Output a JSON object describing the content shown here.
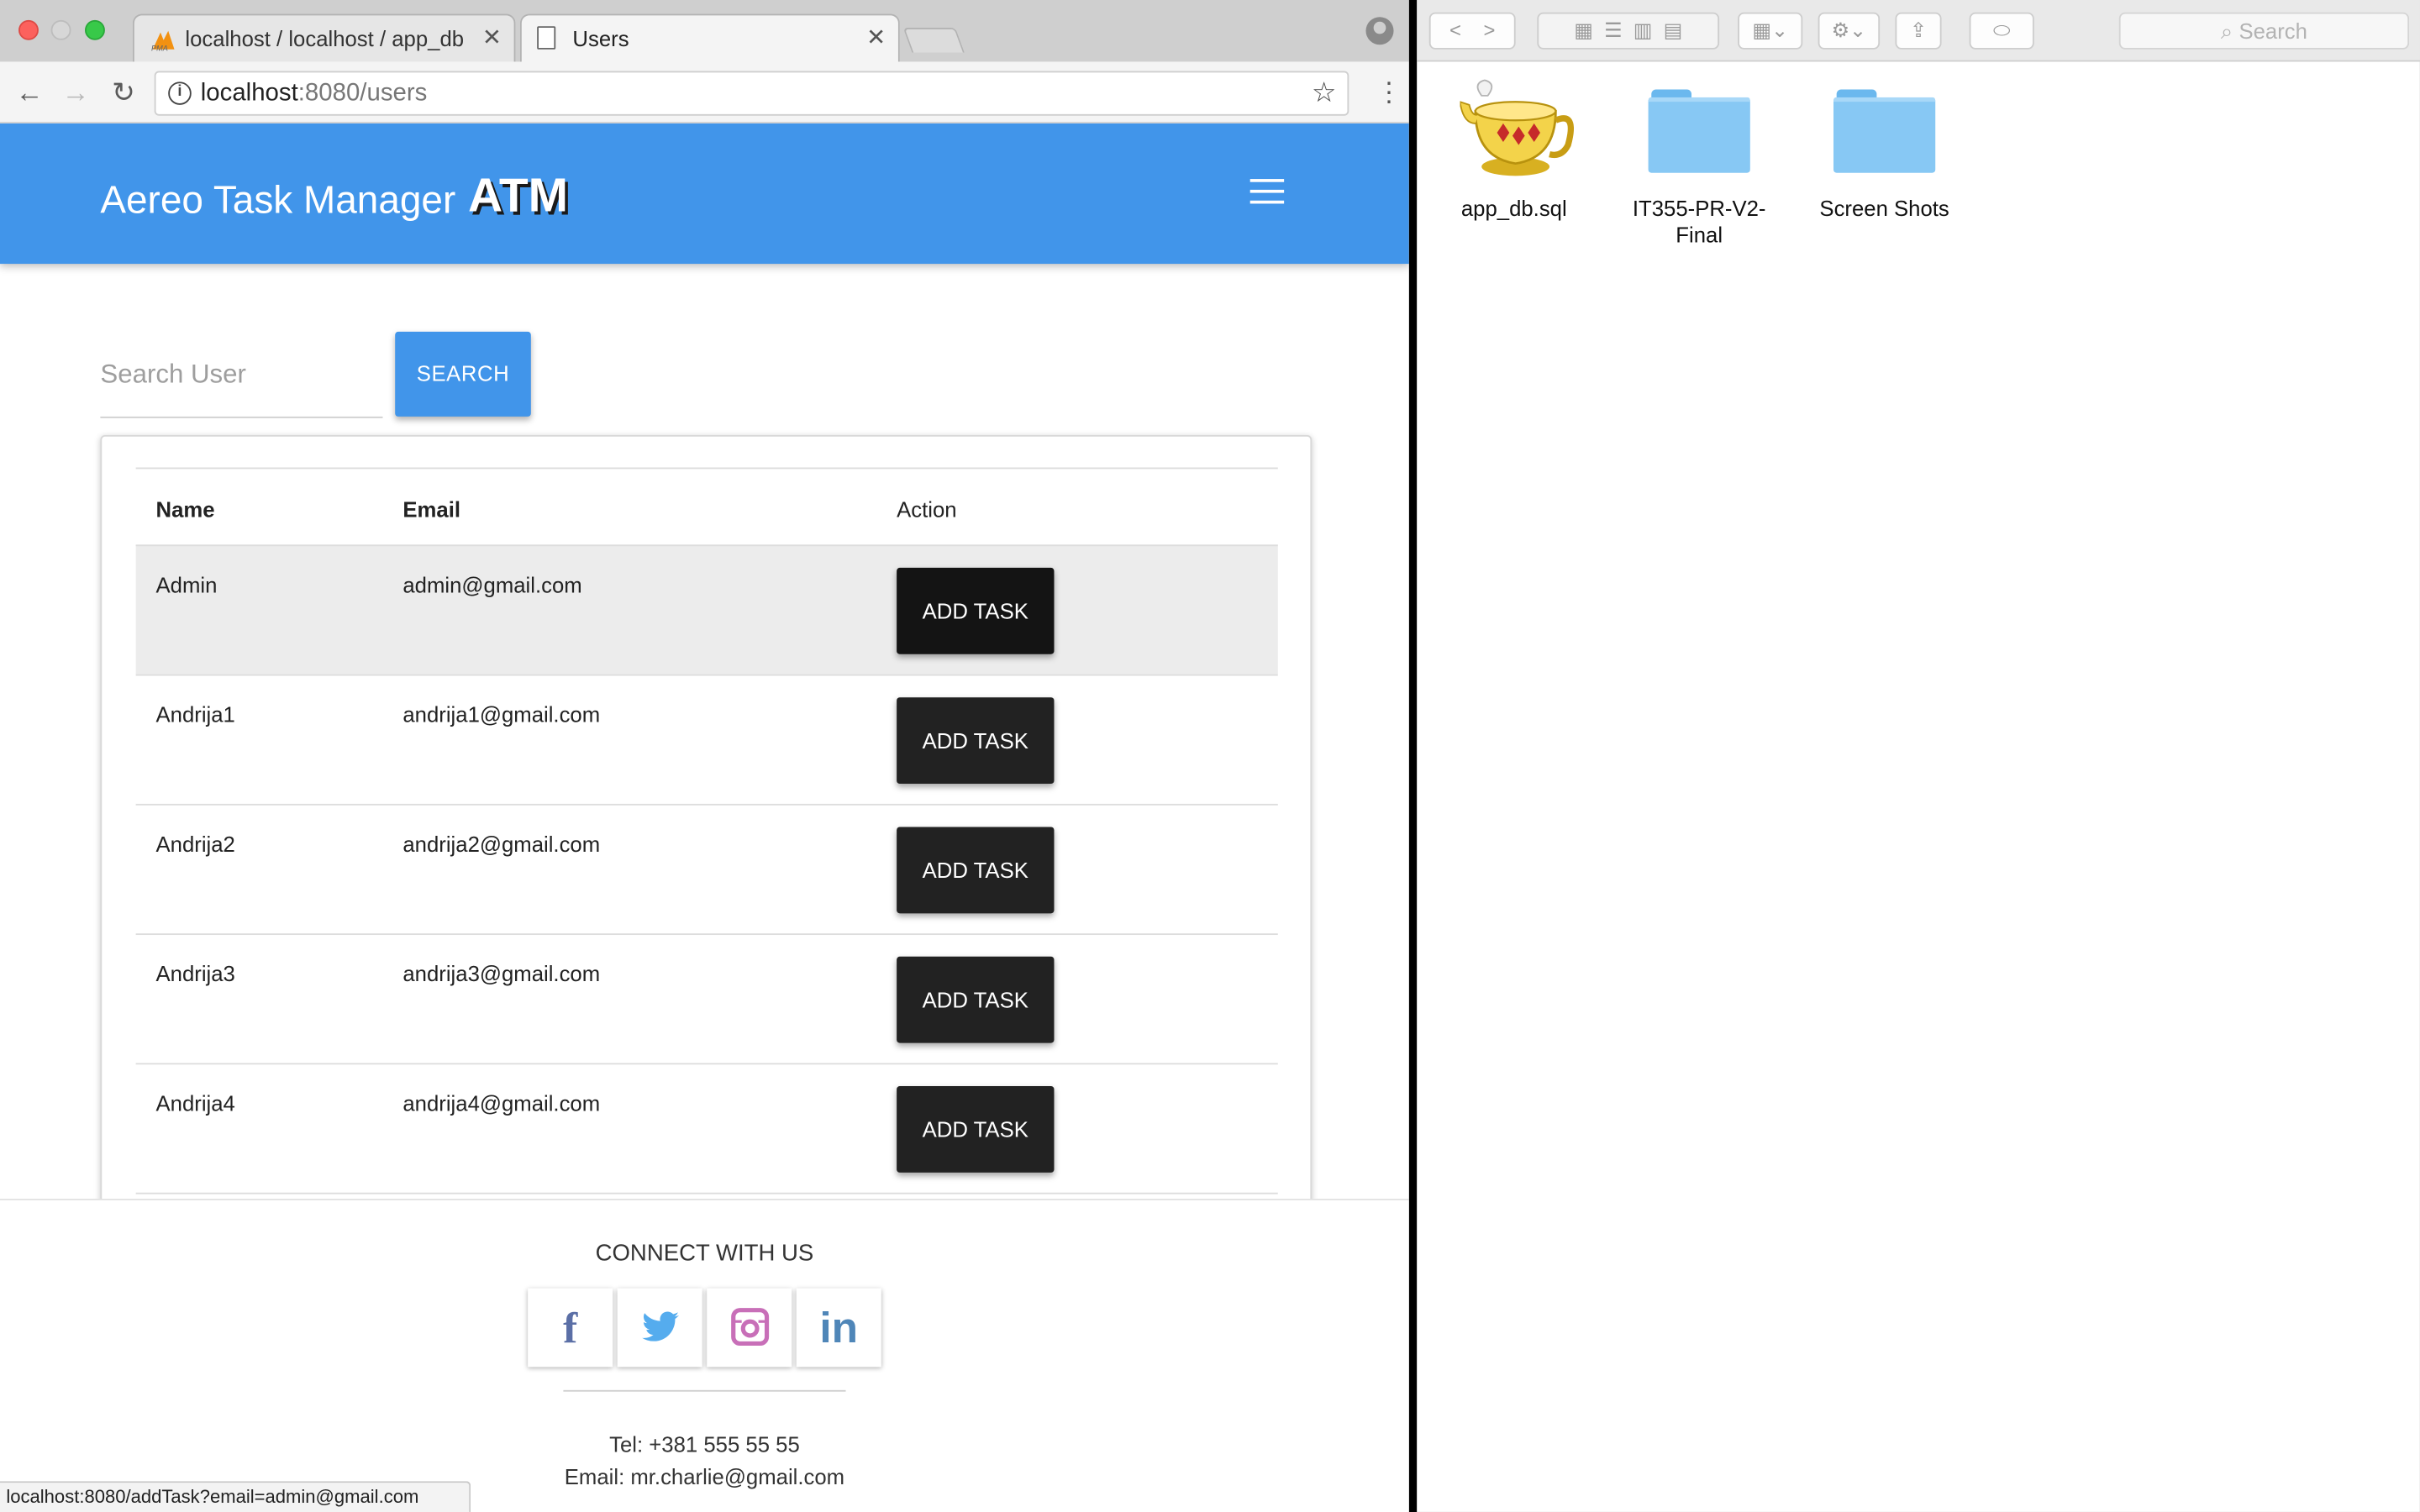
{
  "browser": {
    "tabs": [
      {
        "title": "localhost / localhost / app_db"
      },
      {
        "title": "Users"
      }
    ],
    "address": {
      "host": "localhost",
      "path": ":8080/users"
    },
    "status_url": "localhost:8080/addTask?email=admin@gmail.com"
  },
  "navbar": {
    "brand": "Aereo Task Manager",
    "brand_abbr": "ATM",
    "color": "#4195ea"
  },
  "search": {
    "placeholder": "Search User",
    "button": "SEARCH"
  },
  "table": {
    "headers": [
      "Name",
      "Email",
      "Action"
    ],
    "rows": [
      {
        "name": "Admin",
        "email": "admin@gmail.com",
        "action": "ADD TASK",
        "highlighted": true
      },
      {
        "name": "Andrija1",
        "email": "andrija1@gmail.com",
        "action": "ADD TASK",
        "highlighted": false
      },
      {
        "name": "Andrija2",
        "email": "andrija2@gmail.com",
        "action": "ADD TASK",
        "highlighted": false
      },
      {
        "name": "Andrija3",
        "email": "andrija3@gmail.com",
        "action": "ADD TASK",
        "highlighted": false
      },
      {
        "name": "Andrija4",
        "email": "andrija4@gmail.com",
        "action": "ADD TASK",
        "highlighted": false
      }
    ]
  },
  "footer": {
    "connect": "CONNECT WITH US",
    "socials": [
      {
        "icon": "facebook-icon",
        "glyph": "f",
        "color": "#5b6fa6"
      },
      {
        "icon": "twitter-icon",
        "glyph": "🐦",
        "color": "#55acee"
      },
      {
        "icon": "instagram-icon",
        "glyph": "◙",
        "color": "#c86fb8"
      },
      {
        "icon": "linkedin-icon",
        "glyph": "in",
        "color": "#4f86b8"
      }
    ],
    "tel": "Tel: +381 555 55 55",
    "email": "Email: mr.charlie@gmail.com"
  },
  "finder": {
    "search_placeholder": "Search",
    "items": [
      {
        "label": "app_db.sql",
        "icon": "genie-lamp-icon"
      },
      {
        "label": "IT355-PR-V2-Final",
        "icon": "folder-icon"
      },
      {
        "label": "Screen Shots",
        "icon": "folder-icon"
      }
    ]
  }
}
